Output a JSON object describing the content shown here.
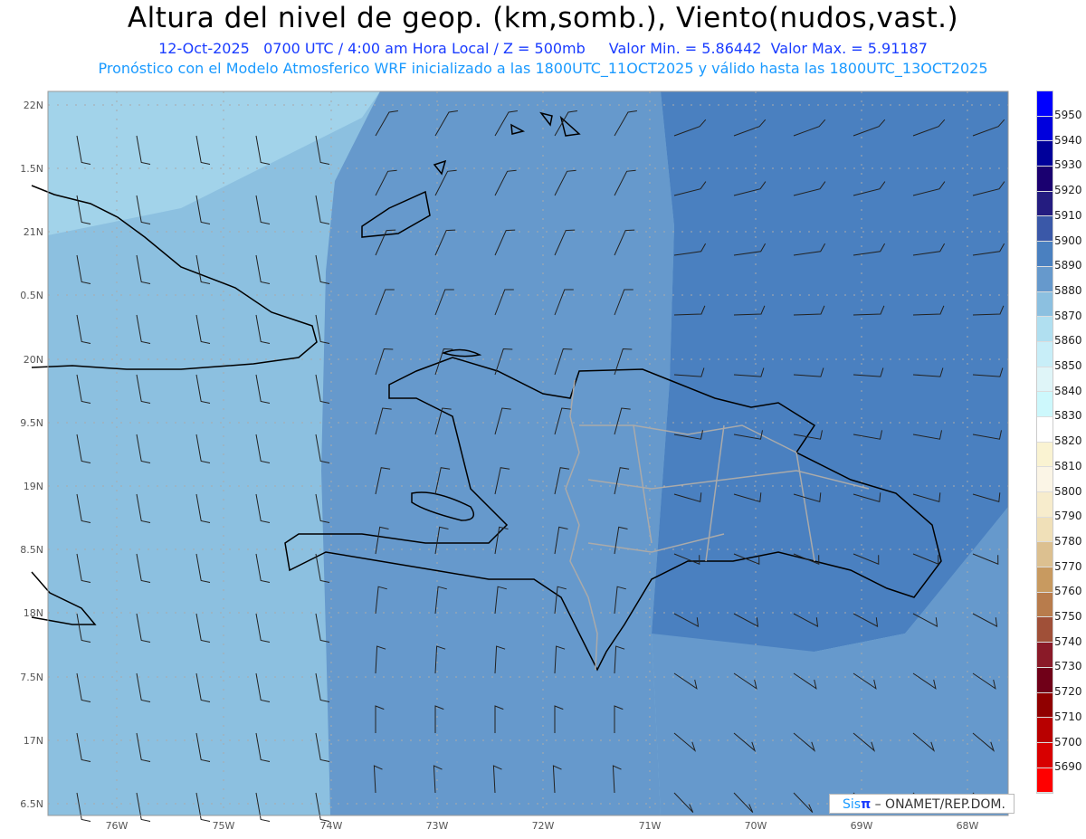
{
  "header": {
    "title": "Altura del nivel de geop. (km,somb.), Viento(nudos,vast.)",
    "date": "12-Oct-2025",
    "time": "0700 UTC / 4:00 am Hora Local / Z = 500mb",
    "min": "Valor Min. = 5.86442",
    "max": "Valor Max. = 5.91187",
    "forecast": "Pronóstico con el Modelo Atmosferico WRF inicializado a las 1800UTC_11OCT2025 y válido hasta las  1800UTC_13OCT2025"
  },
  "axes": {
    "lon_labels": [
      "76W",
      "75W",
      "74W",
      "73W",
      "72W",
      "71W",
      "70W",
      "69W",
      "68W"
    ],
    "lat_labels": [
      "22N",
      "1.5N",
      "21N",
      "0.5N",
      "20N",
      "9.5N",
      "19N",
      "8.5N",
      "18N",
      "7.5N",
      "17N",
      "6.5N"
    ]
  },
  "colorbar": {
    "labels": [
      "5950",
      "5940",
      "5930",
      "5920",
      "5910",
      "5900",
      "5890",
      "5880",
      "5870",
      "5860",
      "5850",
      "5840",
      "5830",
      "5820",
      "5810",
      "5800",
      "5790",
      "5780",
      "5770",
      "5760",
      "5750",
      "5740",
      "5730",
      "5720",
      "5710",
      "5700",
      "5690"
    ],
    "colors": [
      "#0000ff",
      "#0000dd",
      "#00009a",
      "#1a0070",
      "#241c80",
      "#3a58a8",
      "#4a80c0",
      "#6699cc",
      "#8cc0e0",
      "#b0dff0",
      "#c8eef8",
      "#dff5f8",
      "#cdf8fc",
      "#ffffff",
      "#faf3d2",
      "#fbf5e6",
      "#f7eccc",
      "#f0e0b8",
      "#dcc090",
      "#c89a60",
      "#b87c4c",
      "#a05038",
      "#8a1a28",
      "#700018",
      "#900000",
      "#b80000",
      "#d80000",
      "#ff0000"
    ]
  },
  "credit": {
    "sis": "Sis",
    "pi": "π",
    "rest": " – ONAMET/REP.DOM."
  }
}
